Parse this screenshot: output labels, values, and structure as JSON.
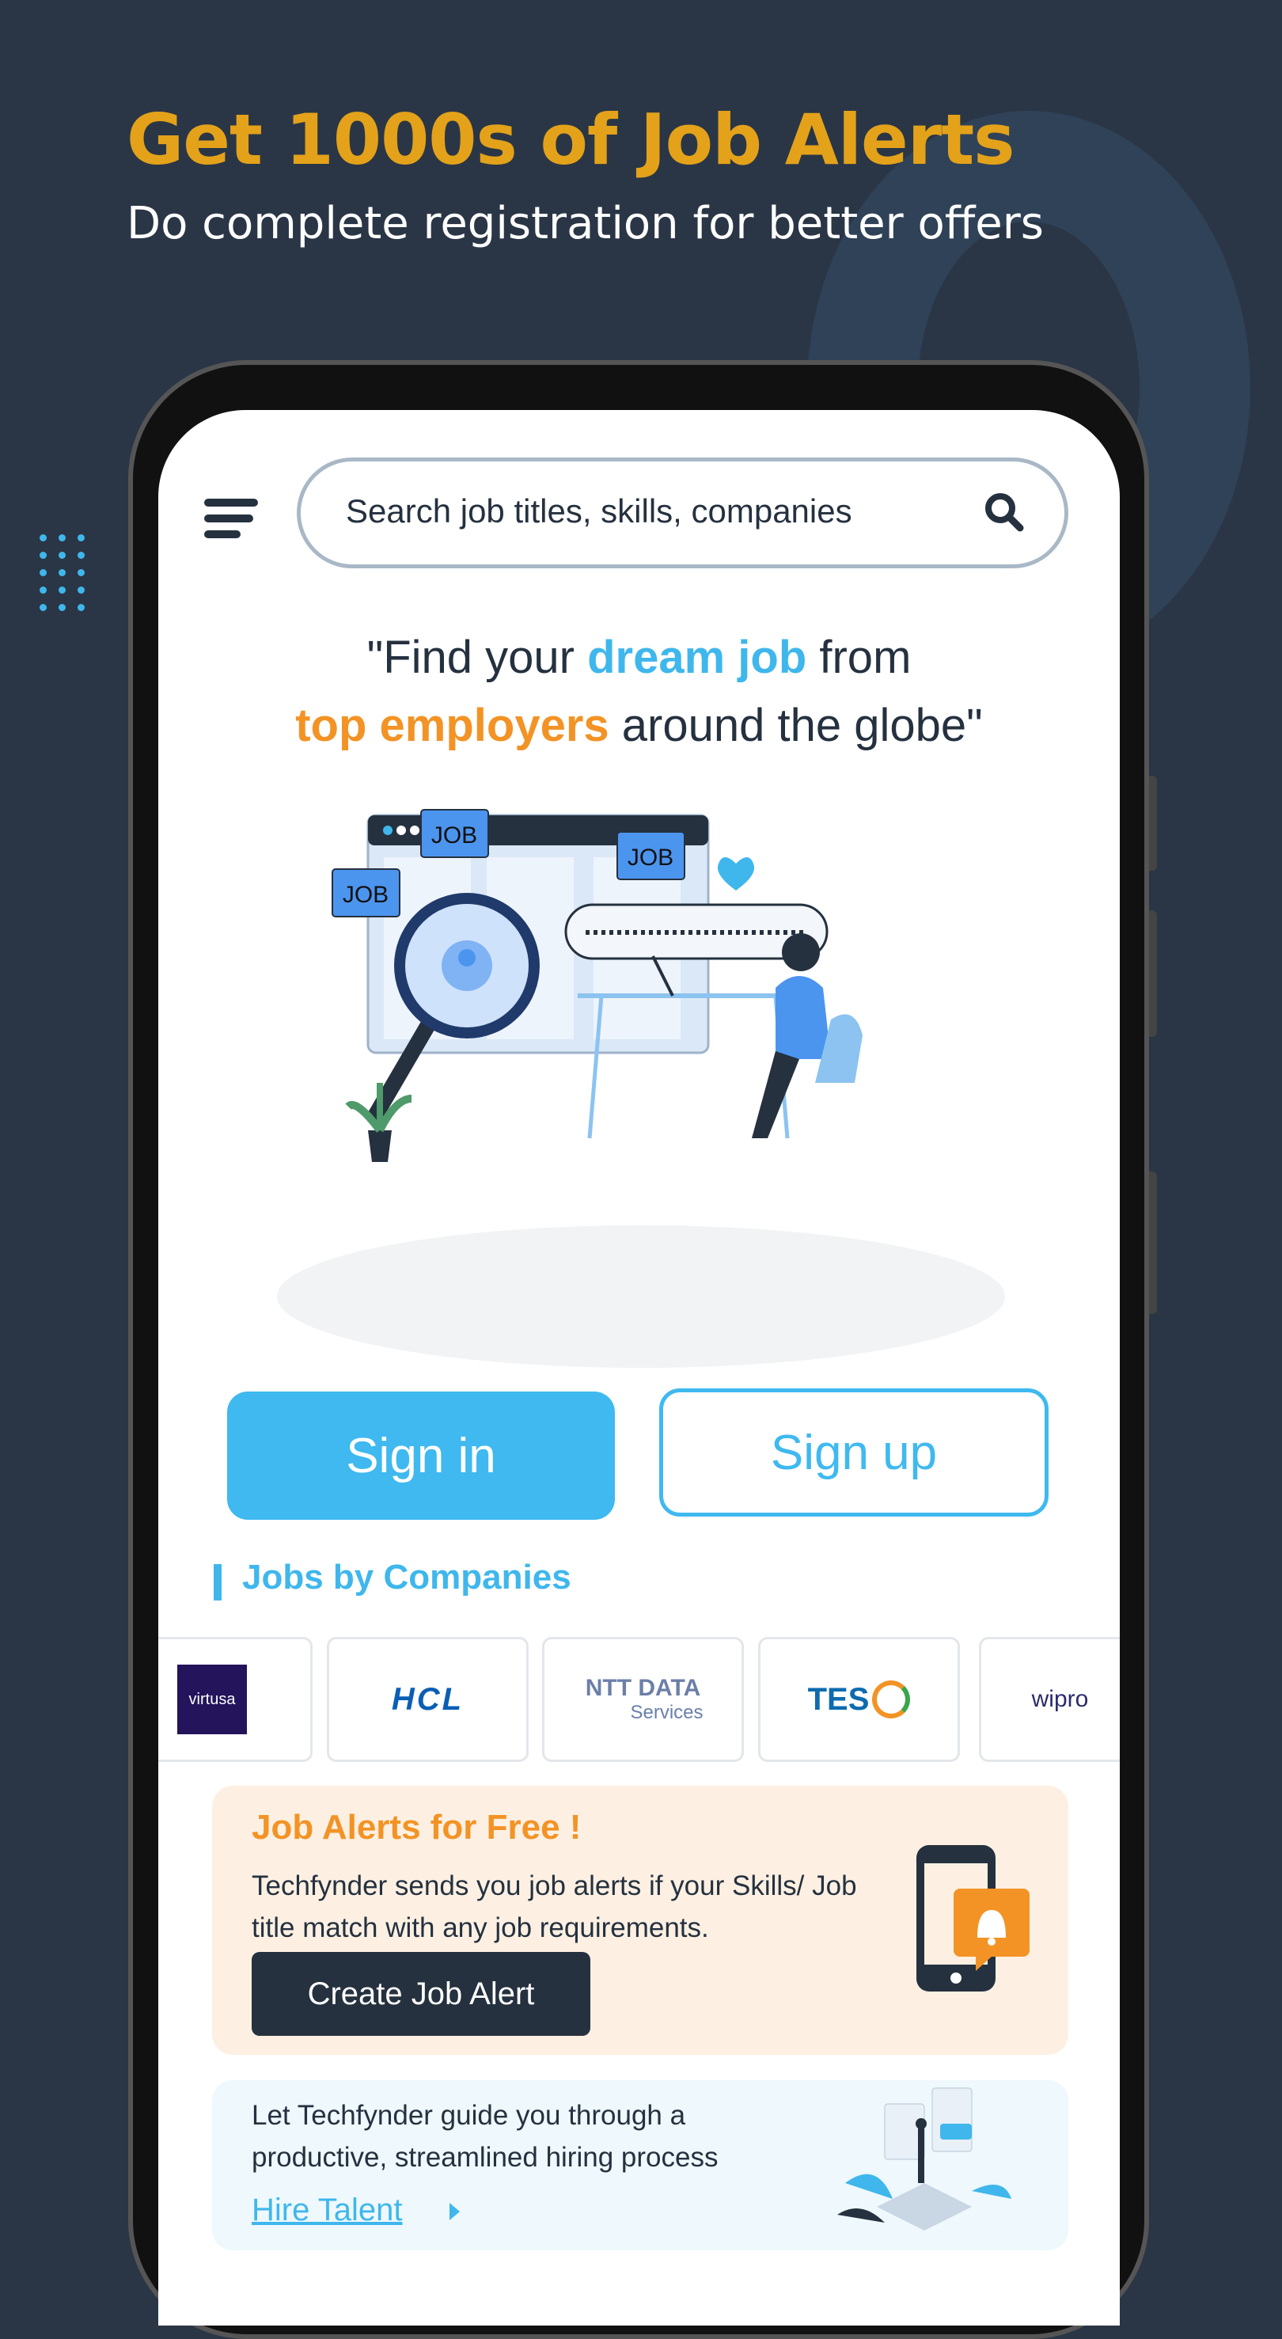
{
  "promo": {
    "headline": "Get 1000s of Job Alerts",
    "subline": "Do complete registration for better offers"
  },
  "app": {
    "search": {
      "placeholder": "Search job titles, skills, companies",
      "icon": "search-icon"
    },
    "menu_icon": "menu-icon",
    "tagline": {
      "part1": "\"Find your ",
      "highlight1": "dream job",
      "part2": " from",
      "highlight2": "top employers",
      "part3": " around the globe\""
    },
    "hero": {
      "bubbles": [
        "JOB",
        "JOB",
        "JOB"
      ]
    },
    "auth": {
      "signin_label": "Sign in",
      "signup_label": "Sign up"
    },
    "companies_section": {
      "title": "Jobs by Companies",
      "companies": [
        {
          "name": "virtusa"
        },
        {
          "name": "HCL"
        },
        {
          "name": "NTT DATA",
          "sub": "Services"
        },
        {
          "name": "TES"
        },
        {
          "name": "wipro"
        }
      ]
    },
    "job_alert_card": {
      "title": "Job Alerts for Free !",
      "description": "Techfynder sends you job alerts if your Skills/ Job title match with any job requirements.",
      "button_label": "Create Job Alert"
    },
    "hire_card": {
      "description": "Let Techfynder guide you through a productive, streamlined hiring process",
      "link_label": "Hire Talent"
    }
  },
  "colors": {
    "background": "#2a3646",
    "headline": "#e3a21a",
    "accent_blue": "#3fb9ef",
    "accent_orange": "#f39325",
    "dark": "#25313f"
  }
}
